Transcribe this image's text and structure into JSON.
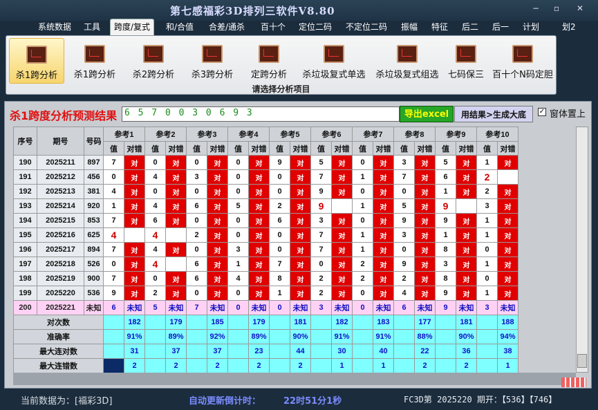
{
  "window": {
    "title": "第七感福彩3D排列三软件V8.80",
    "min": "−",
    "max": "▫",
    "close": "✕"
  },
  "menu": [
    "系统数据",
    "工具",
    "跨度/复式",
    "和/合值",
    "合差/通杀",
    "百十个",
    "定位二码",
    "不定位二码",
    "振幅",
    "特征",
    "后二",
    "后一",
    "计划",
    "划2"
  ],
  "ribbon": {
    "buttons": [
      "杀1跨分析",
      "杀1跨分析",
      "杀2跨分析",
      "杀3跨分析",
      "定跨分析",
      "杀垃圾复式单选",
      "杀垃圾复式组选",
      "七码保三",
      "百十个N码定胆"
    ],
    "footer": "请选择分析项目"
  },
  "result": {
    "title": "杀1跨度分析预测结果",
    "value": "6 5 7 0 0 3 0 6 9 3",
    "excel_label": "导出excel",
    "generate_label": "用结果>生成大底",
    "top_label": "窗体置上",
    "top_check": "✓"
  },
  "table": {
    "h_seq": "序号",
    "h_period": "期号",
    "h_num": "号码",
    "refs": [
      "参考1",
      "参考2",
      "参考3",
      "参考4",
      "参考5",
      "参考6",
      "参考7",
      "参考8",
      "参考9",
      "参考10"
    ],
    "val_label": "值",
    "check_label": "对错",
    "rows": [
      {
        "seq": "190",
        "period": "2025211",
        "num": "897",
        "v": [
          "7",
          "0",
          "0",
          "0",
          "9",
          "5",
          "0",
          "3",
          "5",
          "1"
        ],
        "c": [
          "对",
          "对",
          "对",
          "对",
          "对",
          "对",
          "对",
          "对",
          "对",
          "对"
        ]
      },
      {
        "seq": "191",
        "period": "2025212",
        "num": "456",
        "v": [
          "0",
          "4",
          "3",
          "0",
          "0",
          "7",
          "1",
          "7",
          "6",
          "2"
        ],
        "c": [
          "对",
          "对",
          "对",
          "对",
          "对",
          "对",
          "对",
          "对",
          "对",
          ""
        ]
      },
      {
        "seq": "192",
        "period": "2025213",
        "num": "381",
        "v": [
          "4",
          "0",
          "0",
          "0",
          "0",
          "9",
          "0",
          "0",
          "1",
          "2"
        ],
        "c": [
          "对",
          "对",
          "对",
          "对",
          "对",
          "对",
          "对",
          "对",
          "对",
          "对"
        ]
      },
      {
        "seq": "193",
        "period": "2025214",
        "num": "920",
        "v": [
          "1",
          "4",
          "6",
          "5",
          "2",
          "9",
          "1",
          "5",
          "9",
          "3"
        ],
        "c": [
          "对",
          "对",
          "对",
          "对",
          "对",
          "",
          "对",
          "对",
          "",
          "对"
        ]
      },
      {
        "seq": "194",
        "period": "2025215",
        "num": "853",
        "v": [
          "7",
          "6",
          "0",
          "0",
          "6",
          "3",
          "0",
          "9",
          "9",
          "1"
        ],
        "c": [
          "对",
          "对",
          "对",
          "对",
          "对",
          "对",
          "对",
          "对",
          "对",
          "对"
        ]
      },
      {
        "seq": "195",
        "period": "2025216",
        "num": "625",
        "v": [
          "4",
          "4",
          "2",
          "0",
          "0",
          "7",
          "1",
          "3",
          "1",
          "1"
        ],
        "c": [
          "",
          "",
          "对",
          "对",
          "对",
          "对",
          "对",
          "对",
          "对",
          "对"
        ]
      },
      {
        "seq": "196",
        "period": "2025217",
        "num": "894",
        "v": [
          "7",
          "4",
          "0",
          "3",
          "0",
          "7",
          "1",
          "0",
          "8",
          "0"
        ],
        "c": [
          "对",
          "对",
          "对",
          "对",
          "对",
          "对",
          "对",
          "对",
          "对",
          "对"
        ]
      },
      {
        "seq": "197",
        "period": "2025218",
        "num": "526",
        "v": [
          "0",
          "4",
          "6",
          "1",
          "7",
          "0",
          "2",
          "9",
          "3",
          "1"
        ],
        "c": [
          "对",
          "",
          "对",
          "对",
          "对",
          "对",
          "对",
          "对",
          "对",
          "对"
        ]
      },
      {
        "seq": "198",
        "period": "2025219",
        "num": "900",
        "v": [
          "7",
          "0",
          "6",
          "4",
          "8",
          "2",
          "2",
          "2",
          "8",
          "0"
        ],
        "c": [
          "对",
          "对",
          "对",
          "对",
          "对",
          "对",
          "对",
          "对",
          "对",
          "对"
        ]
      },
      {
        "seq": "199",
        "period": "2025220",
        "num": "536",
        "v": [
          "9",
          "2",
          "0",
          "0",
          "1",
          "2",
          "0",
          "4",
          "9",
          "1"
        ],
        "c": [
          "对",
          "对",
          "对",
          "对",
          "对",
          "对",
          "对",
          "对",
          "对",
          "对"
        ]
      }
    ],
    "unknown": {
      "seq": "200",
      "period": "2025221",
      "num": "未知",
      "v": [
        "6",
        "5",
        "7",
        "0",
        "0",
        "3",
        "0",
        "6",
        "9",
        "3"
      ],
      "c": [
        "未知",
        "未知",
        "未知",
        "未知",
        "未知",
        "未知",
        "未知",
        "未知",
        "未知",
        "未知"
      ]
    },
    "stats": [
      {
        "label": "对次数",
        "vals": [
          "182",
          "179",
          "185",
          "179",
          "181",
          "182",
          "183",
          "177",
          "181",
          "188"
        ]
      },
      {
        "label": "准确率",
        "vals": [
          "91%",
          "89%",
          "92%",
          "89%",
          "90%",
          "91%",
          "91%",
          "88%",
          "90%",
          "94%"
        ]
      },
      {
        "label": "最大连对数",
        "vals": [
          "31",
          "37",
          "37",
          "23",
          "44",
          "30",
          "40",
          "22",
          "36",
          "38"
        ]
      },
      {
        "label": "最大连错数",
        "vals": [
          "2",
          "2",
          "2",
          "2",
          "2",
          "1",
          "1",
          "2",
          "2",
          "1"
        ]
      }
    ]
  },
  "status": {
    "current_label": "当前数据为：[福彩3D]",
    "countdown_label": "自动更新倒计时：",
    "countdown": "22时51分1秒",
    "info": "FC3D第 2025220 期开：【536】【746】"
  }
}
